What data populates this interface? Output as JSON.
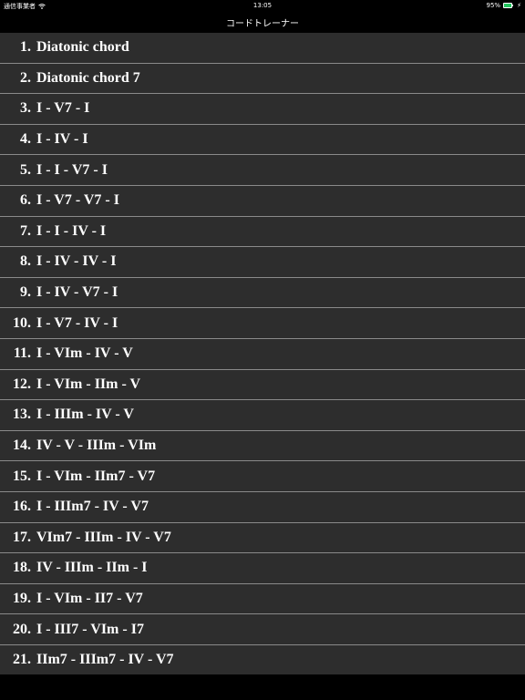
{
  "status_bar": {
    "carrier": "通信事業者",
    "time": "13:05",
    "battery_percent": "95%",
    "battery_level": 0.95
  },
  "nav": {
    "title": "コードトレーナー"
  },
  "items": [
    {
      "num": "1.",
      "label": "Diatonic chord"
    },
    {
      "num": "2.",
      "label": "Diatonic chord 7"
    },
    {
      "num": "3.",
      "label": "I - V7 - I"
    },
    {
      "num": "4.",
      "label": "I - IV - I"
    },
    {
      "num": "5.",
      "label": "I - I - V7 - I"
    },
    {
      "num": "6.",
      "label": "I - V7 - V7 - I"
    },
    {
      "num": "7.",
      "label": "I - I - IV - I"
    },
    {
      "num": "8.",
      "label": "I - IV - IV - I"
    },
    {
      "num": "9.",
      "label": "I - IV - V7 - I"
    },
    {
      "num": "10.",
      "label": "I - V7 - IV - I"
    },
    {
      "num": "11.",
      "label": "I - VIm - IV - V"
    },
    {
      "num": "12.",
      "label": "I - VIm - IIm - V"
    },
    {
      "num": "13.",
      "label": "I - IIIm - IV - V"
    },
    {
      "num": "14.",
      "label": "IV - V - IIIm - VIm"
    },
    {
      "num": "15.",
      "label": "I - VIm - IIm7 - V7"
    },
    {
      "num": "16.",
      "label": "I - IIIm7 - IV - V7"
    },
    {
      "num": "17.",
      "label": "VIm7 - IIIm - IV - V7"
    },
    {
      "num": "18.",
      "label": "IV - IIIm - IIm - I"
    },
    {
      "num": "19.",
      "label": "I - VIm - II7 - V7"
    },
    {
      "num": "20.",
      "label": "I - III7 - VIm - I7"
    },
    {
      "num": "21.",
      "label": "IIm7 - IIIm7 - IV - V7"
    }
  ]
}
